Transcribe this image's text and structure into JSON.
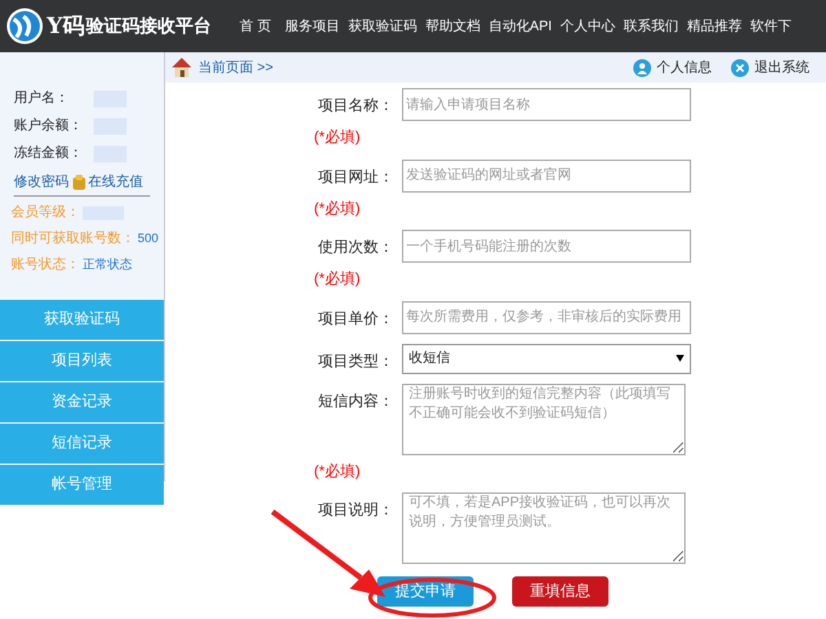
{
  "header": {
    "logo_mark": "Y码",
    "logo_text": "验证码接收平台",
    "nav": [
      {
        "label": "首 页"
      },
      {
        "label": "服务项目"
      },
      {
        "label": "获取验证码"
      },
      {
        "label": "帮助文档"
      },
      {
        "label": "自动化API"
      },
      {
        "label": "个人中心"
      },
      {
        "label": "联系我们"
      },
      {
        "label": "精品推荐"
      },
      {
        "label": "软件下"
      }
    ]
  },
  "breadcrumb": {
    "label": "当前页面 >>"
  },
  "top_actions": [
    {
      "kind": "user",
      "label": "个人信息"
    },
    {
      "kind": "logout",
      "label": "退出系统"
    }
  ],
  "account": {
    "fields": [
      {
        "label": "用户名："
      },
      {
        "label": "账户余额："
      },
      {
        "label": "冻结金额："
      }
    ],
    "links": [
      {
        "label": "修改密码",
        "kind": "plain"
      },
      {
        "label": "在线充值",
        "kind": "coins"
      }
    ],
    "stats": [
      {
        "label": "会员等级："
      },
      {
        "label": "同时可获取账号数：",
        "value": "500"
      },
      {
        "label": "账号状态：",
        "value": "正常状态"
      }
    ]
  },
  "menu": [
    {
      "label": "获取验证码"
    },
    {
      "label": "项目列表"
    },
    {
      "label": "资金记录"
    },
    {
      "label": "短信记录"
    },
    {
      "label": "帐号管理"
    }
  ],
  "form": {
    "fields": [
      {
        "kind": "input",
        "label": "项目名称：",
        "placeholder": "请输入申请项目名称",
        "required": "(*必填)"
      },
      {
        "kind": "input",
        "label": "项目网址：",
        "placeholder": "发送验证码的网址或者官网",
        "required": "(*必填)"
      },
      {
        "kind": "input",
        "label": "使用次数：",
        "placeholder": "一个手机号码能注册的次数",
        "required": "(*必填)"
      },
      {
        "kind": "input",
        "label": "项目单价：",
        "placeholder": "每次所需费用，仅参考，非审核后的实际费用"
      },
      {
        "kind": "select",
        "label": "项目类型：",
        "value": "收短信"
      },
      {
        "kind": "textarea",
        "label": "短信内容：",
        "placeholder": "注册账号时收到的短信完整内容（此项填写不正确可能会收不到验证码短信）",
        "required": "(*必填)"
      },
      {
        "kind": "textarea",
        "label": "项目说明：",
        "placeholder": "可不填，若是APP接收验证码，也可以再次说明，方便管理员测试。"
      }
    ],
    "buttons": [
      {
        "kind": "primary",
        "label": "提交申请"
      },
      {
        "kind": "danger",
        "label": "重填信息"
      }
    ]
  }
}
